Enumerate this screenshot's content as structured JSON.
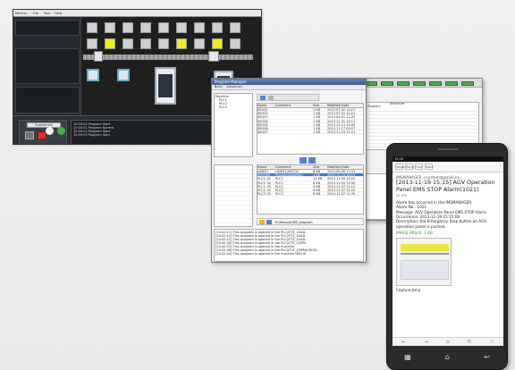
{
  "monitor": {
    "menu": [
      "Monitor",
      "File",
      "Tool",
      "Help"
    ],
    "button_primary": "System Init",
    "status_lines": [
      "10:00:00  Program Start",
      "10:00:01  Program Normal",
      "10:00:02  Program Start",
      "10:00:03  Program Start"
    ]
  },
  "manager": {
    "title": "Program Manager",
    "tabs": [
      "Basic",
      "Advanced"
    ],
    "tree_root": "Machine",
    "tree_items": [
      "PLC1",
      "PLC2",
      "PLC3"
    ],
    "columns": [
      "Name",
      "Comment",
      "Size",
      "Modified Date"
    ],
    "rows_top": [
      [
        "SEQ01",
        "",
        "1 KB",
        "2013.07.02 10:21"
      ],
      [
        "SEQ02",
        "",
        "1 KB",
        "2013.07.02 10:21"
      ],
      [
        "SEQ03",
        "",
        "1 KB",
        "2013.05.01 11:20"
      ],
      [
        "SEQ04",
        "",
        "1 KB",
        "2013.11.01 15:11"
      ],
      [
        "SEQ05",
        "",
        "1 KB",
        "2013.11.14 15:09"
      ],
      [
        "SEQ06",
        "",
        "1 KB",
        "2013.11.17 09:57"
      ],
      [
        "SEQ07",
        "",
        "1 KB",
        "2013.11.19 13:21"
      ]
    ],
    "rows_bottom": [
      [
        "LINE01",
        "LINE01-MSTOS",
        "8 KB",
        "2013.09.06 11:51"
      ],
      [
        "SYSTEM",
        "ProgramSetsMain",
        "1 KB",
        "2013.10.29 10:15"
      ],
      [
        "PLC1_01",
        "PLC1",
        "12 KB",
        "2013.11.05 13:22"
      ],
      [
        "PLC1_02",
        "PLC1",
        "8 KB",
        "2013.11.05 13:30"
      ],
      [
        "PLC1_03",
        "PLC1",
        "4 KB",
        "2013.11.07 11:15"
      ],
      [
        "PLC2_01",
        "PLC2",
        "6 KB",
        "2013.11.07 11:20"
      ],
      [
        "PLC3_01",
        "PLC3",
        "8 KB",
        "2013.11.07 11:35"
      ]
    ],
    "path_value": "K:\\Manual\\IMS_program",
    "log_lines": [
      "[10:42:11] This program is opened in the PLC(ST)T_LOAD.",
      "[10:42:14] This program is opened in the PLC(ST)T_LOAD.",
      "[10:42:21] This program is opened in the PLC(ST)T_LOAD.",
      "[10:42:28] This program is opened in the PLC(ST)T_CDPM.",
      "[10:42:31] This program is opened in the machine.",
      "[10:42:38] This program is opened in the PLC(ST)T_CDPM(HZHZ).",
      "[10:42:44] This program is opened in the machine DM1-B."
    ]
  },
  "overview": {
    "panel_program": "Program",
    "panel_structure": "Structure"
  },
  "phone": {
    "status_time": "15:20",
    "tabs": [
      "Inbox",
      "Reply",
      "Fwd",
      "More"
    ],
    "from": "IMSMANAGER <system@gmail.co...",
    "subject": "[2013-11-19 15:15] AGV Operation Panel EMS STOP Alarm(1021)",
    "to_label": "to me",
    "greeting": "Alarm has occurred in the IMSMANAGER.",
    "alarm_no": "Alarm No.: 1021",
    "message": "Message: AGV Operation Panel EMS STOP Alarm",
    "occurrence": "Occurrence: 2013-11-19 15:15:00",
    "description": "Description: the Emergency Stop button on AGV operation panel is pushed.",
    "image_caption": "IMAGE Attach: 1 KB",
    "capture_label": "Capture.bmp"
  }
}
